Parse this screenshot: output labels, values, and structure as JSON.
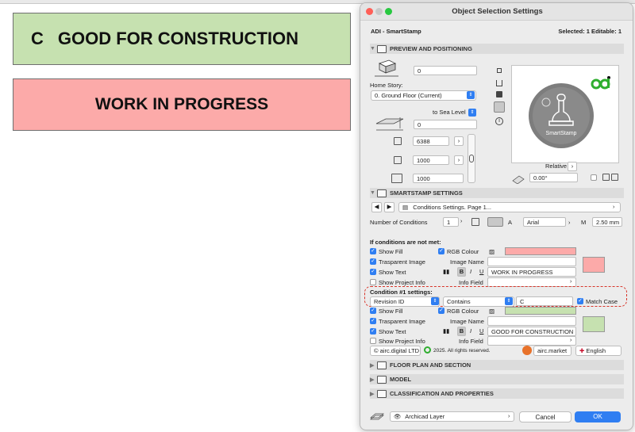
{
  "canvas": {
    "stamp_good": {
      "letter": "C",
      "text": "GOOD FOR CONSTRUCTION",
      "color": "#c6e1b0"
    },
    "stamp_wip": {
      "text": "WORK IN PROGRESS",
      "color": "#fcaaa9"
    }
  },
  "dialog": {
    "title": "Object Selection Settings",
    "object_name": "ADI - SmartStamp",
    "selection_info": "Selected: 1 Editable: 1",
    "preview_section": {
      "heading": "PREVIEW AND POSITIONING",
      "elevation_value": "0",
      "home_story_label": "Home Story:",
      "home_story_value": "0. Ground Floor (Current)",
      "to_sea_level_label": "to Sea Level",
      "sea_level_value": "0",
      "x_size": "6388",
      "y_size": "1000",
      "z_size": "1000",
      "preview_label": "SmartStamp",
      "relative_label": "Relative",
      "angle_value": "0.00°"
    },
    "smartstamp_section": {
      "heading": "SMARTSTAMP SETTINGS",
      "conditions_page": "Conditions Settings. Page 1...",
      "number_of_conditions_label": "Number of Conditions",
      "number_of_conditions": "1",
      "font_name": "Arial",
      "text_size": "2.50 mm",
      "not_met_heading": "If conditions are not met:",
      "not_met": {
        "show_fill": "Show Fill",
        "rgb_colour": "RGB Colour",
        "fill_color": "#fcaaa9",
        "transparent_image": "Trasparent Image",
        "image_name": "Image Name",
        "show_text": "Show Text",
        "text_value": "WORK IN PROGRESS",
        "show_project_info": "Show Project Info",
        "info_field": "Info Field"
      },
      "condition1_heading": "Condition #1 settings:",
      "condition1": {
        "property": "Revision ID",
        "operator": "Contains",
        "value": "C",
        "match_case": "Match Case",
        "show_fill": "Show Fill",
        "rgb_colour": "RGB Colour",
        "fill_color": "#c6e1b0",
        "transparent_image": "Trasparent Image",
        "image_name": "Image Name",
        "show_text": "Show Text",
        "text_value": "GOOD FOR CONSTRUCTION",
        "show_project_info": "Show Project Info",
        "info_field": "Info Field"
      },
      "footer": {
        "copyright_link": "airc.digital LTD",
        "rights": "2025. All rights reserved.",
        "market_link": "airc.market",
        "language": "English"
      }
    },
    "collapsed_sections": [
      "FLOOR PLAN AND SECTION",
      "MODEL",
      "CLASSIFICATION AND PROPERTIES"
    ],
    "bottom": {
      "layer": "Archicad Layer",
      "cancel": "Cancel",
      "ok": "OK"
    }
  }
}
